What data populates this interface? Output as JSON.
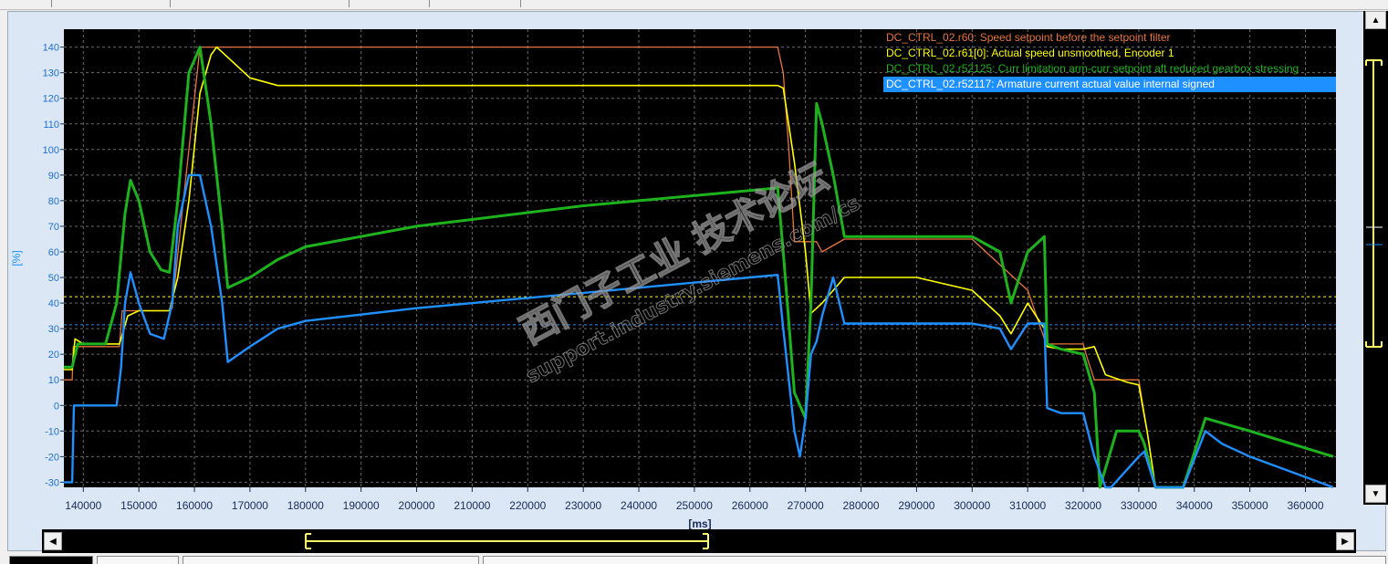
{
  "chart_data": {
    "type": "line",
    "xlabel": "[ms]",
    "ylabel": "[%]",
    "xlim": [
      136500,
      365500
    ],
    "ylim": [
      -32,
      147
    ],
    "x_ticks": [
      "140000",
      "150000",
      "160000",
      "170000",
      "180000",
      "190000",
      "200000",
      "210000",
      "220000",
      "230000",
      "240000",
      "250000",
      "260000",
      "270000",
      "280000",
      "290000",
      "300000",
      "310000",
      "320000",
      "330000",
      "340000",
      "350000",
      "360000"
    ],
    "y_ticks": [
      "140",
      "130",
      "120",
      "110",
      "100",
      "90",
      "80",
      "70",
      "60",
      "50",
      "40",
      "30",
      "20",
      "10",
      "0",
      "-10",
      "-20",
      "-30"
    ],
    "grid": true,
    "legend_position": "top-right",
    "series": [
      {
        "name": "DC_CTRL_02.r60: Speed setpoint before the setpoint filter",
        "color": "#e8743b",
        "x": [
          136500,
          138000,
          138200,
          146500,
          147000,
          155500,
          156000,
          158000,
          160000,
          161000,
          265000,
          266000,
          267000,
          268000,
          272000,
          273000,
          277000,
          280000,
          300000,
          310000,
          313000,
          313500,
          320000,
          320500,
          322000,
          330000,
          331500,
          333000
        ],
        "y": [
          10,
          10,
          23,
          23,
          37,
          37,
          38,
          80,
          120,
          140,
          140,
          130,
          100,
          64,
          64,
          60,
          65,
          65,
          65,
          45,
          26,
          24,
          24,
          20,
          10,
          10,
          -10,
          -32
        ]
      },
      {
        "name": "DC_CTRL_02.r61[0]: Actual speed unsmoothed, Encoder 1",
        "color": "#ffff00",
        "x": [
          136500,
          138000,
          138500,
          140000,
          146500,
          148000,
          150000,
          152000,
          155500,
          157000,
          159000,
          161000,
          163000,
          164000,
          166000,
          170000,
          175000,
          180000,
          190000,
          220000,
          250000,
          265000,
          266000,
          268000,
          270000,
          271000,
          273000,
          275000,
          277000,
          280000,
          290000,
          300000,
          305000,
          307000,
          310000,
          313000,
          313500,
          316000,
          320000,
          322000,
          324000,
          328000,
          330000,
          331500,
          333000
        ],
        "y": [
          14,
          14,
          26,
          24,
          24,
          35,
          37,
          37,
          37,
          50,
          80,
          122,
          137,
          140,
          136,
          128,
          125,
          125,
          125,
          125,
          125,
          125,
          124,
          95,
          60,
          36,
          40,
          45,
          50,
          50,
          50,
          45,
          35,
          28,
          40,
          30,
          23,
          22,
          22,
          23,
          12,
          9,
          8,
          -10,
          -32
        ]
      },
      {
        "name": "DC_CTRL_02.r52125: Curr limitation arm-curr setpoint aft reduced gearbox stressing",
        "color": "#1db31d",
        "x": [
          136500,
          138000,
          139000,
          144000,
          146000,
          147500,
          148500,
          150000,
          152000,
          154000,
          155500,
          157000,
          159000,
          161000,
          163000,
          165000,
          166000,
          170000,
          175000,
          180000,
          200000,
          230000,
          260000,
          265000,
          266000,
          268000,
          270000,
          271000,
          272000,
          273000,
          275000,
          277000,
          280000,
          290000,
          300000,
          305000,
          307000,
          310000,
          313000,
          313500,
          316000,
          320000,
          322000,
          323000,
          326000,
          330000,
          331000,
          333000,
          335000,
          338000,
          342000,
          350000,
          365000
        ],
        "y": [
          15,
          15,
          24,
          24,
          40,
          75,
          88,
          80,
          60,
          53,
          52,
          80,
          130,
          140,
          110,
          70,
          46,
          50,
          57,
          62,
          70,
          78,
          84,
          85,
          60,
          5,
          -5,
          40,
          118,
          110,
          90,
          66,
          66,
          66,
          66,
          60,
          40,
          60,
          66,
          24,
          22,
          20,
          5,
          -32,
          -10,
          -10,
          -15,
          -32,
          -32,
          -32,
          -5,
          -10,
          -20
        ]
      },
      {
        "name": "DC_CTRL_02.r52117: Armature current actual value internal signed",
        "color": "#1e90ff",
        "x": [
          136500,
          138000,
          138300,
          146000,
          146800,
          147500,
          148500,
          150000,
          152000,
          154500,
          156000,
          157000,
          159000,
          161000,
          163000,
          165000,
          166000,
          170000,
          175000,
          180000,
          200000,
          230000,
          260000,
          265000,
          266000,
          268000,
          269000,
          270000,
          271000,
          272000,
          273000,
          275000,
          277000,
          280000,
          290000,
          300000,
          305000,
          307000,
          310000,
          313000,
          313500,
          316000,
          320000,
          322000,
          324000,
          325000,
          330000,
          331000,
          333000,
          335000,
          338000,
          342000,
          345000,
          350000,
          365000
        ],
        "y": [
          -30,
          -30,
          0,
          0,
          15,
          40,
          52,
          40,
          28,
          26,
          40,
          70,
          90,
          90,
          70,
          40,
          17,
          23,
          30,
          33,
          38,
          44,
          50,
          51,
          30,
          -10,
          -20,
          -5,
          20,
          25,
          35,
          50,
          32,
          32,
          32,
          32,
          30,
          22,
          32,
          32,
          -1,
          -3,
          -3,
          -20,
          -32,
          -32,
          -20,
          -18,
          -32,
          -32,
          -32,
          -10,
          -15,
          -20,
          -32
        ]
      }
    ]
  },
  "reference_lines": [
    {
      "y": 42.5,
      "color": "#ffff00"
    },
    {
      "y": 31.5,
      "color": "#1e90ff"
    }
  ],
  "watermark": {
    "line1": "西门子工业 技术论坛",
    "line2": "support.industry.siemens.com/cs"
  },
  "scroll": {
    "up_icon": "triangle-up",
    "down_icon": "triangle-down",
    "left_icon": "triangle-left",
    "right_icon": "triangle-right"
  }
}
